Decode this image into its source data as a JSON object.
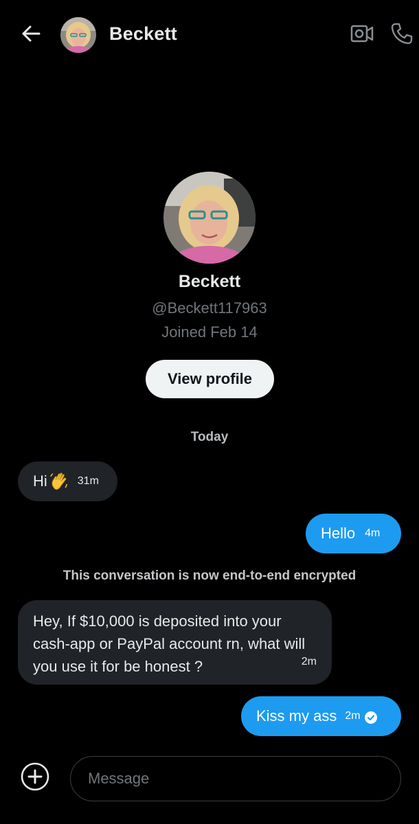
{
  "header": {
    "contact_name": "Beckett",
    "back_icon": "arrow-left-icon",
    "video_icon": "video-camera-icon",
    "phone_icon": "phone-icon"
  },
  "profile": {
    "name": "Beckett",
    "handle": "@Beckett117963",
    "joined": "Joined Feb 14",
    "view_profile_label": "View profile"
  },
  "conversation": {
    "date_separator": "Today",
    "encryption_notice": "This conversation is now end-to-end encrypted",
    "messages": [
      {
        "direction": "incoming",
        "text": "Hi",
        "emoji": "waving-hand-emoji",
        "time": "31m"
      },
      {
        "direction": "outgoing",
        "text": "Hello",
        "time": "4m"
      },
      {
        "direction": "incoming",
        "text": "Hey, If $10,000 is deposited into your cash-app or PayPal account rn, what will you use it for be honest ?",
        "time": "2m"
      },
      {
        "direction": "outgoing",
        "text": "Kiss my ass",
        "time": "2m",
        "status": "read-checkmark-icon"
      }
    ]
  },
  "composer": {
    "placeholder": "Message",
    "value": "",
    "add_icon": "plus-circle-icon"
  },
  "colors": {
    "background": "#000000",
    "incoming_bubble": "#202327",
    "outgoing_bubble": "#1d9bf0",
    "primary_text": "#e7e9ea",
    "secondary_text": "#71767b",
    "button_bg": "#eff3f4"
  }
}
